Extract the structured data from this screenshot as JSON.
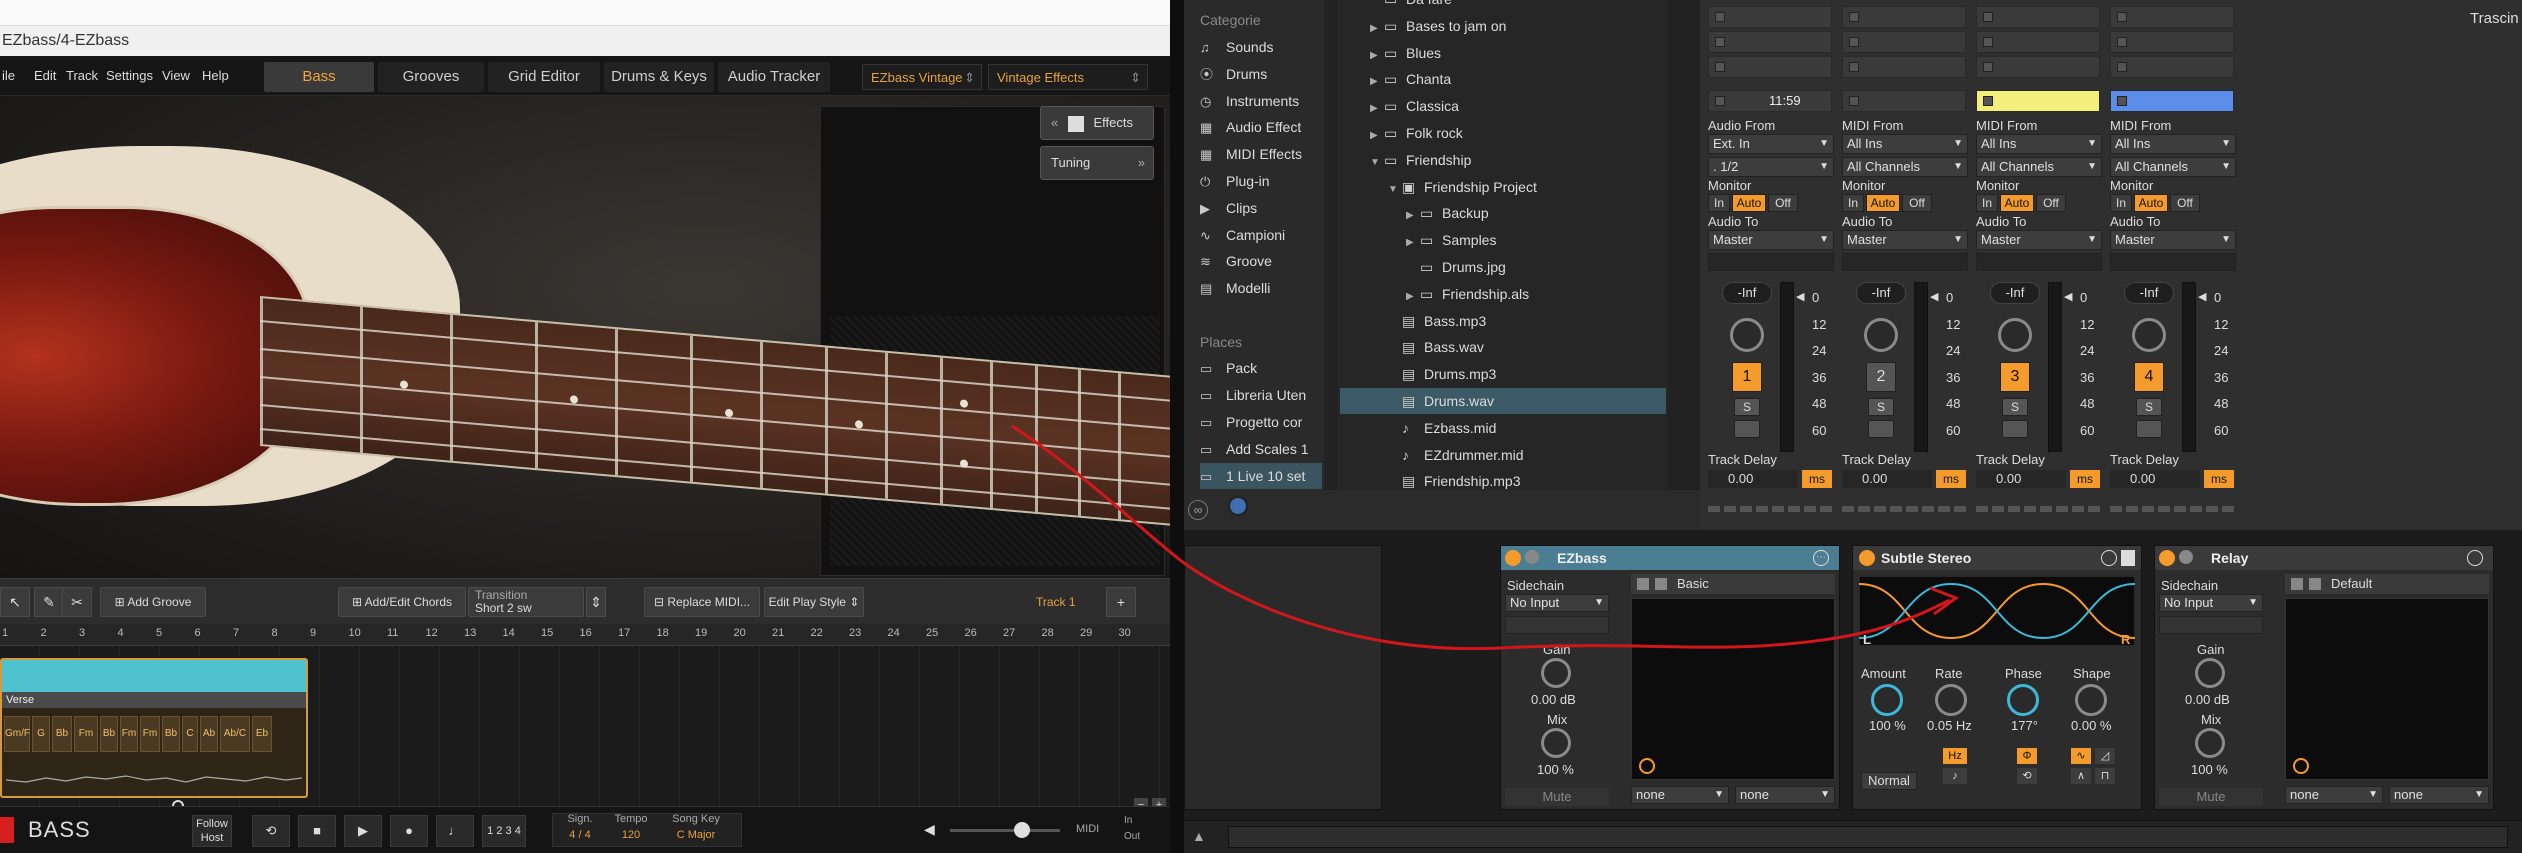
{
  "ezbass": {
    "window_title": "EZbass/4-EZbass",
    "menu": [
      "ile",
      "Edit",
      "Track",
      "Settings",
      "View",
      "Help"
    ],
    "tabs": [
      "Bass",
      "Grooves",
      "Grid Editor",
      "Drums & Keys",
      "Audio Tracker"
    ],
    "active_tab": "Bass",
    "preset_instrument": "EZbass Vintage",
    "preset_effects": "Vintage Effects",
    "effects_button": "Effects",
    "tuning_button": "Tuning",
    "toolbar": {
      "add_groove": "Add Groove",
      "add_edit_chords": "Add/Edit Chords",
      "transition_label": "Transition",
      "transition_value": "Short 2 sw",
      "replace_midi": "Replace MIDI...",
      "edit_play_style": "Edit Play Style",
      "track_name": "Track 1",
      "add_track": "+"
    },
    "ruler": [
      "1",
      "2",
      "3",
      "4",
      "5",
      "6",
      "7",
      "8",
      "9",
      "10",
      "11",
      "12",
      "13",
      "14",
      "15",
      "16",
      "17",
      "18",
      "19",
      "20",
      "21",
      "22",
      "23",
      "24",
      "25",
      "26",
      "27",
      "28",
      "29",
      "30"
    ],
    "part_name": "Verse",
    "chords": [
      "Gm/F",
      "G",
      "Bb",
      "Fm",
      "Bb",
      "Fm",
      "Fm",
      "Bb",
      "C",
      "Ab",
      "Ab/C",
      "Eb"
    ],
    "transport": {
      "logo": "BASS",
      "follow_host": "Follow Host",
      "signature_label": "Sign.",
      "signature_value": "4 / 4",
      "tempo_label": "Tempo",
      "tempo_value": "120",
      "key_label": "Song Key",
      "key_value": "C Major",
      "counter": "1 2 3 4",
      "midi_label": "MIDI",
      "midi_in": "In",
      "midi_out": "Out"
    }
  },
  "live": {
    "categories_header": "Categorie",
    "categories": [
      {
        "icon": "music-note-icon",
        "glyph": "♫",
        "label": "Sounds"
      },
      {
        "icon": "drums-icon",
        "glyph": "⦿",
        "label": "Drums"
      },
      {
        "icon": "clock-icon",
        "glyph": "◷",
        "label": "Instruments"
      },
      {
        "icon": "audio-effect-icon",
        "glyph": "▦",
        "label": "Audio Effect"
      },
      {
        "icon": "midi-effect-icon",
        "glyph": "▦",
        "label": "MIDI Effects"
      },
      {
        "icon": "plugin-icon",
        "glyph": "⏻",
        "label": "Plug-in"
      },
      {
        "icon": "clips-icon",
        "glyph": "▶",
        "label": "Clips"
      },
      {
        "icon": "samples-icon",
        "glyph": "∿",
        "label": "Campioni"
      },
      {
        "icon": "groove-icon",
        "glyph": "≋",
        "label": "Groove"
      },
      {
        "icon": "templates-icon",
        "glyph": "▤",
        "label": "Modelli"
      }
    ],
    "places_header": "Places",
    "places": [
      {
        "label": "Pack"
      },
      {
        "label": "Libreria Uten"
      },
      {
        "label": "Progetto cor"
      },
      {
        "label": "Add Scales 1"
      },
      {
        "label": "1 Live 10 set"
      }
    ],
    "files": [
      {
        "tri": "",
        "type": "folder",
        "label": "Da fare",
        "indent": 0
      },
      {
        "tri": "▶",
        "type": "folder",
        "label": "Bases to jam on",
        "indent": 0
      },
      {
        "tri": "▶",
        "type": "folder",
        "label": "Blues",
        "indent": 0
      },
      {
        "tri": "▶",
        "type": "folder",
        "label": "Chanta",
        "indent": 0
      },
      {
        "tri": "▶",
        "type": "folder",
        "label": "Classica",
        "indent": 0
      },
      {
        "tri": "▶",
        "type": "folder",
        "label": "Folk rock",
        "indent": 0
      },
      {
        "tri": "▼",
        "type": "folder",
        "label": "Friendship",
        "indent": 0
      },
      {
        "tri": "▼",
        "type": "project",
        "label": "Friendship Project",
        "indent": 1
      },
      {
        "tri": "▶",
        "type": "folder",
        "label": "Backup",
        "indent": 2
      },
      {
        "tri": "▶",
        "type": "folder",
        "label": "Samples",
        "indent": 2
      },
      {
        "tri": "",
        "type": "image",
        "label": "Drums.jpg",
        "indent": 2
      },
      {
        "tri": "▶",
        "type": "live-set",
        "label": "Friendship.als",
        "indent": 2
      },
      {
        "tri": "",
        "type": "audio",
        "label": "Bass.mp3",
        "indent": 1
      },
      {
        "tri": "",
        "type": "audio",
        "label": "Bass.wav",
        "indent": 1
      },
      {
        "tri": "",
        "type": "audio",
        "label": "Drums.mp3",
        "indent": 1
      },
      {
        "tri": "",
        "type": "audio",
        "label": "Drums.wav",
        "indent": 1
      },
      {
        "tri": "",
        "type": "midi",
        "label": "Ezbass.mid",
        "indent": 1
      },
      {
        "tri": "",
        "type": "midi",
        "label": "EZdrummer.mid",
        "indent": 1
      },
      {
        "tri": "",
        "type": "audio",
        "label": "Friendship.mp3",
        "indent": 1
      }
    ],
    "selected_file": "Drums.wav",
    "top_right_label": "Trascin",
    "tracks": [
      {
        "clip": "11:59",
        "clip_color": "#3a3a3a",
        "from_label": "Audio From",
        "from": "Ext. In",
        "ch": ". 1/2",
        "to": "Master",
        "num": "1",
        "num_on": true,
        "delay": "0.00"
      },
      {
        "clip": "",
        "clip_color": "#3a3a3a",
        "from_label": "MIDI From",
        "from": "All Ins",
        "ch": "All Channels",
        "to": "Master",
        "num": "2",
        "num_on": false,
        "delay": "0.00"
      },
      {
        "clip": "",
        "clip_color": "#f4ee7a",
        "from_label": "MIDI From",
        "from": "All Ins",
        "ch": "All Channels",
        "to": "Master",
        "num": "3",
        "num_on": true,
        "delay": "0.00"
      },
      {
        "clip": "",
        "clip_color": "#5b8ee8",
        "from_label": "MIDI From",
        "from": "All Ins",
        "ch": "All Channels",
        "to": "Master",
        "num": "4",
        "num_on": true,
        "delay": "0.00"
      }
    ],
    "mixer_labels": {
      "monitor": "Monitor",
      "audio_to": "Audio To",
      "in": "In",
      "auto": "Auto",
      "off": "Off",
      "inf": "-Inf",
      "solo": "S",
      "track_delay": "Track Delay",
      "ms": "ms",
      "scale": [
        "0",
        "12",
        "24",
        "36",
        "48",
        "60"
      ]
    },
    "devices": {
      "ezbass": {
        "title": "EZbass",
        "sidechain": "Sidechain",
        "sidechain_value": "No Input",
        "preset": "Basic",
        "gain_label": "Gain",
        "gain_value": "0.00 dB",
        "mix_label": "Mix",
        "mix_value": "100 %",
        "mute": "Mute",
        "dd1": "none",
        "dd2": "none"
      },
      "stereo": {
        "title": "Subtle Stereo",
        "amount_label": "Amount",
        "amount_value": "100 %",
        "rate_label": "Rate",
        "rate_value": "0.05 Hz",
        "phase_label": "Phase",
        "phase_value": "177°",
        "shape_label": "Shape",
        "shape_value": "0.00 %",
        "mode": "Normal",
        "hz": "Hz",
        "l": "L",
        "r": "R"
      },
      "relay": {
        "title": "Relay",
        "sidechain": "Sidechain",
        "sidechain_value": "No Input",
        "preset": "Default",
        "gain_label": "Gain",
        "gain_value": "0.00 dB",
        "mix_label": "Mix",
        "mix_value": "100 %",
        "mute": "Mute",
        "dd1": "none",
        "dd2": "none"
      }
    }
  },
  "colors": {
    "accent_orange": "#f59b2c",
    "selection_blue": "#3b5a66",
    "annotation_red": "#d1171b",
    "ez_part_teal": "#4fc2cf"
  }
}
